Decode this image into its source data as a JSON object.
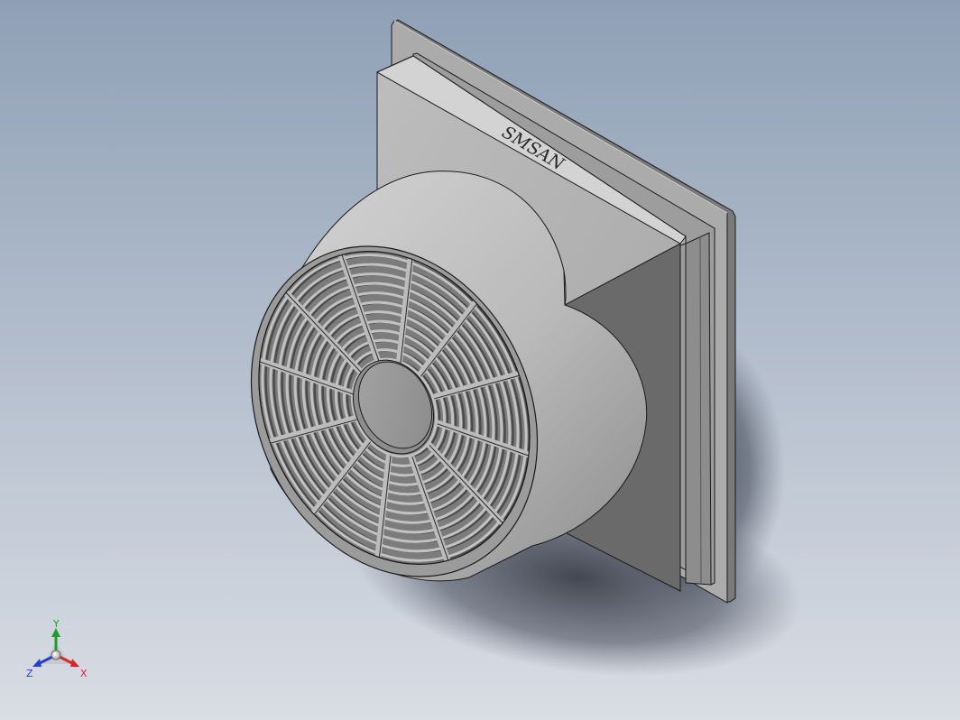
{
  "viewport": {
    "background_top": "#8fa0b6",
    "background_bottom": "#d9dde4"
  },
  "model": {
    "brand_text": "SMSAN",
    "grille_ring_count": 12,
    "grille_spoke_count": 12
  },
  "colors": {
    "body_light": "#c9c9c9",
    "body_mid": "#b3b3b3",
    "body_dark": "#707070",
    "flange": "#a9a9a9",
    "edge": "#1a1a1a",
    "shadow": "#3c4250"
  },
  "triad": {
    "x_label": "X",
    "y_label": "Y",
    "z_label": "Z",
    "x_color": "#d22a2a",
    "y_color": "#1f9c2a",
    "z_color": "#2a3fc8"
  }
}
